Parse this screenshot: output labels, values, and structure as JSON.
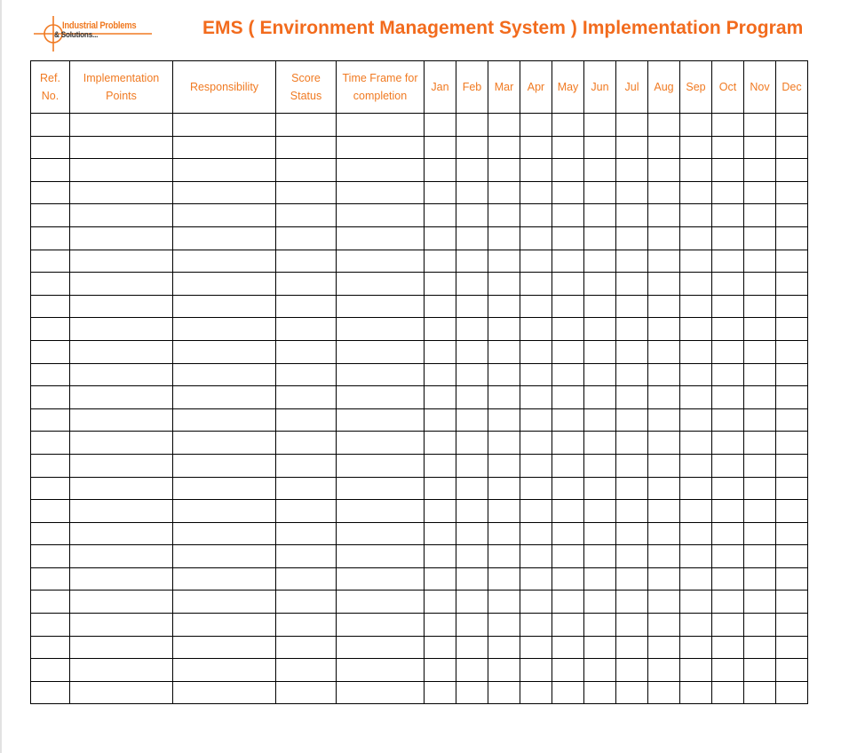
{
  "logo": {
    "line1": "Industrial Problems",
    "line2": "& Solutions...",
    "icon": "crosshair-icon"
  },
  "title": "EMS ( Environment Management System ) Implementation Program",
  "colors": {
    "accent": "#f26b1d",
    "header_text": "#f07a22",
    "grid": "#000000"
  },
  "table": {
    "columns": [
      {
        "key": "ref",
        "lines": [
          "Ref.",
          "No."
        ]
      },
      {
        "key": "points",
        "lines": [
          "Implementation",
          "Points"
        ]
      },
      {
        "key": "responsibility",
        "lines": [
          "Responsibility"
        ]
      },
      {
        "key": "score",
        "lines": [
          "Score",
          "Status"
        ]
      },
      {
        "key": "timeframe",
        "lines": [
          "Time Frame for",
          "completion"
        ]
      },
      {
        "key": "jan",
        "lines": [
          "Jan"
        ]
      },
      {
        "key": "feb",
        "lines": [
          "Feb"
        ]
      },
      {
        "key": "mar",
        "lines": [
          "Mar"
        ]
      },
      {
        "key": "apr",
        "lines": [
          "Apr"
        ]
      },
      {
        "key": "may",
        "lines": [
          "May"
        ]
      },
      {
        "key": "jun",
        "lines": [
          "Jun"
        ]
      },
      {
        "key": "jul",
        "lines": [
          "Jul"
        ]
      },
      {
        "key": "aug",
        "lines": [
          "Aug"
        ]
      },
      {
        "key": "sep",
        "lines": [
          "Sep"
        ]
      },
      {
        "key": "oct",
        "lines": [
          "Oct"
        ]
      },
      {
        "key": "nov",
        "lines": [
          "Nov"
        ]
      },
      {
        "key": "dec",
        "lines": [
          "Dec"
        ]
      }
    ],
    "row_count": 26,
    "rows": []
  }
}
